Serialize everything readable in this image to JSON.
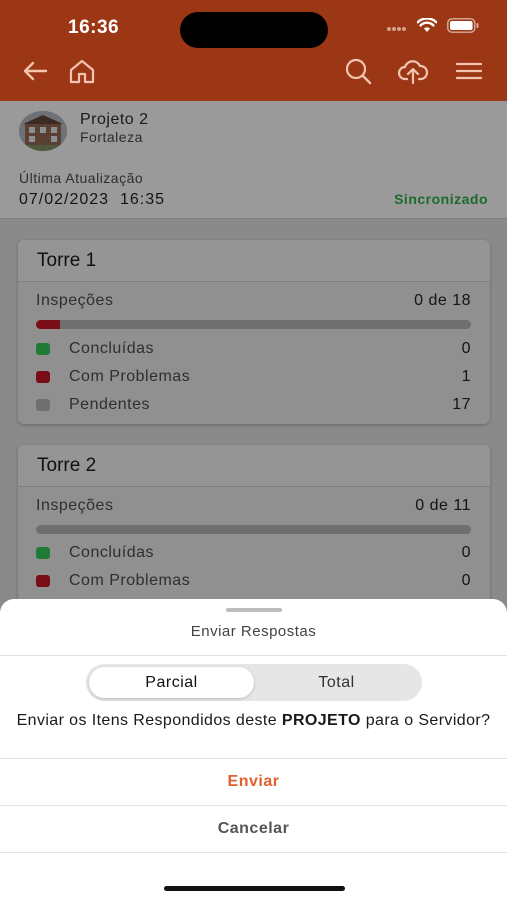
{
  "status_bar": {
    "time": "16:36"
  },
  "header": {
    "icons": [
      "back-arrow-icon",
      "home-icon",
      "search-icon",
      "cloud-upload-icon",
      "menu-icon"
    ],
    "color": "#9c3715"
  },
  "project": {
    "name": "Projeto 2",
    "city": "Fortaleza",
    "last_update_label": "Última Atualização",
    "last_update_value": "07/02/2023  16:35",
    "sync_status": "Sincronizado"
  },
  "towers": [
    {
      "title": "Torre 1",
      "inspections_label": "Inspeções",
      "inspections_value": "0 de 18",
      "progress_fraction": 0.056,
      "legend": [
        {
          "label": "Concluídas",
          "value": "0",
          "color": "#1f7a35"
        },
        {
          "label": "Com Problemas",
          "value": "1",
          "color": "#7a0d16"
        },
        {
          "label": "Pendentes",
          "value": "17",
          "color": "#6f6f6f"
        }
      ]
    },
    {
      "title": "Torre 2",
      "inspections_label": "Inspeções",
      "inspections_value": "0 de 11",
      "progress_fraction": 0,
      "legend": [
        {
          "label": "Concluídas",
          "value": "0",
          "color": "#1f7a35"
        },
        {
          "label": "Com Problemas",
          "value": "0",
          "color": "#7a0d16"
        }
      ]
    }
  ],
  "sheet": {
    "title": "Enviar Respostas",
    "segments": [
      "Parcial",
      "Total"
    ],
    "selected_segment": "Parcial",
    "message_before": "Enviar os Itens Respondidos deste ",
    "message_bold": "PROJETO",
    "message_after": " para o Servidor?",
    "send_label": "Enviar",
    "cancel_label": "Cancelar",
    "accent_color": "#e0602e"
  }
}
